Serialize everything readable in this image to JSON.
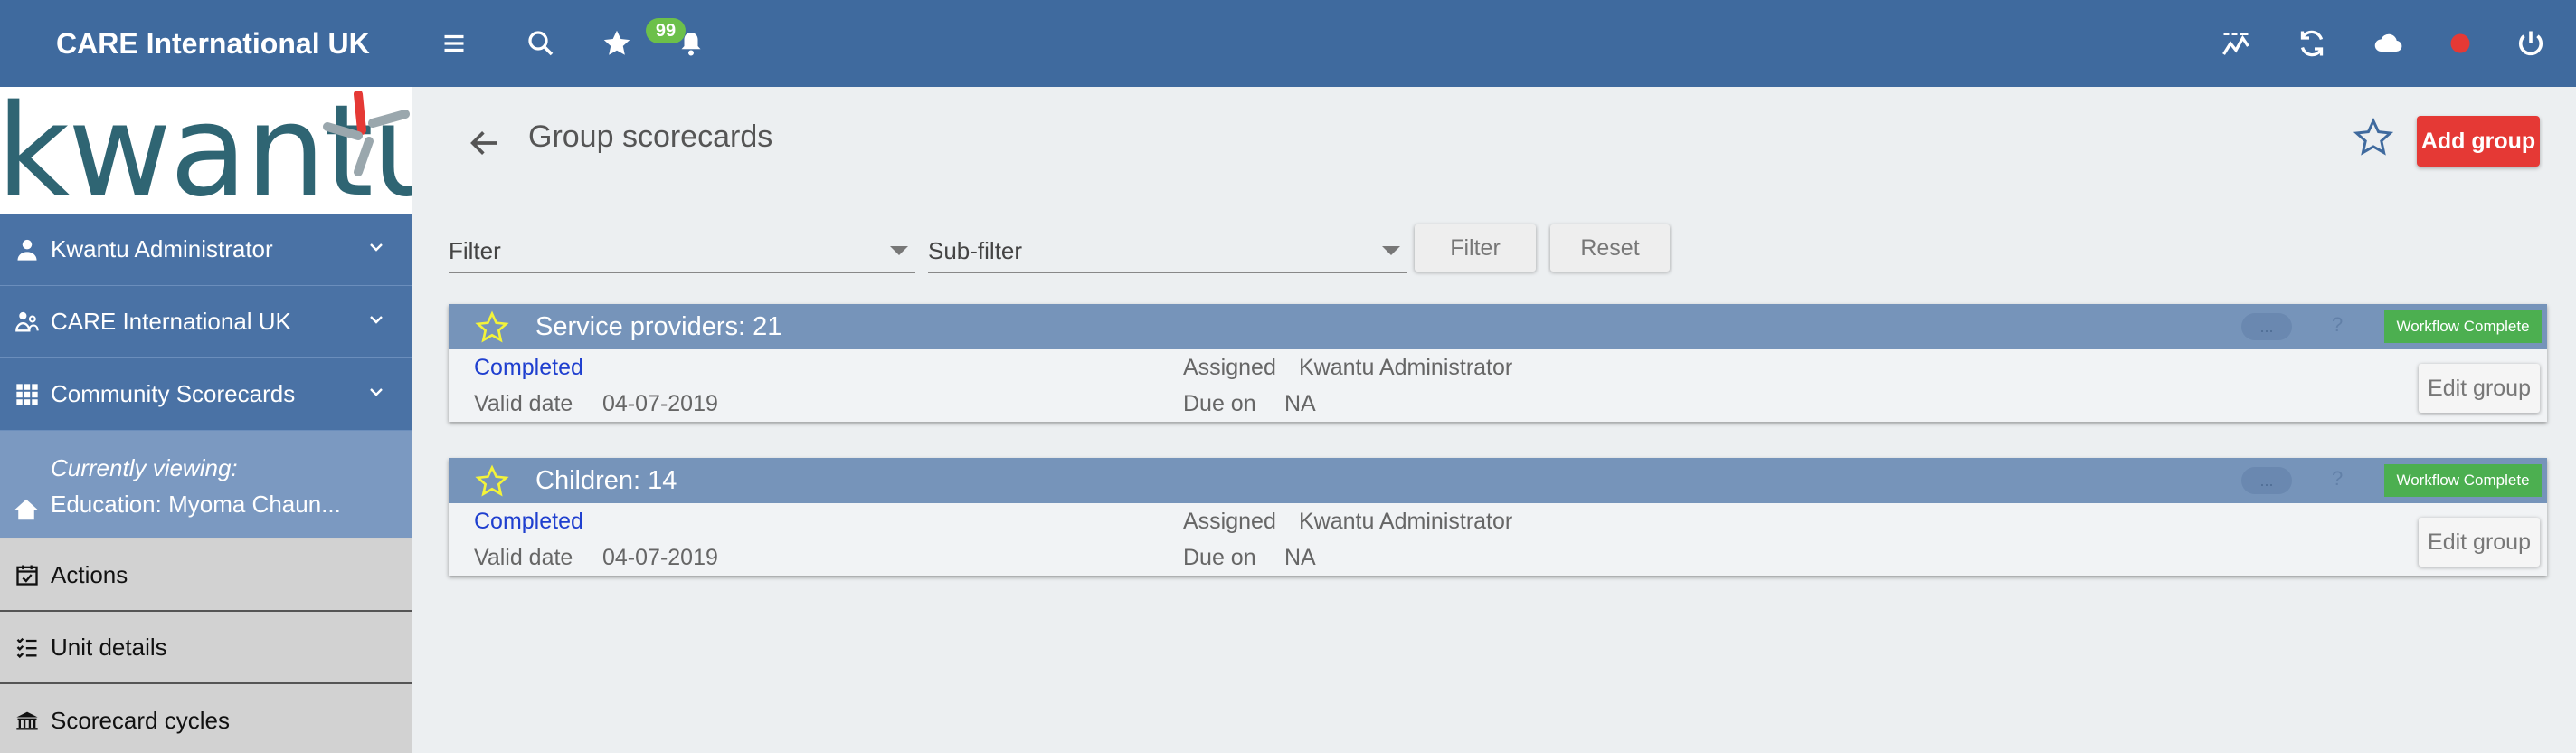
{
  "header": {
    "app_title": "CARE International UK",
    "notification_count": "99",
    "icons": [
      "menu-icon",
      "search-icon",
      "star-icon",
      "bell-icon",
      "analytics-icon",
      "sync-icon",
      "cloud-icon",
      "status-dot-icon",
      "power-icon"
    ]
  },
  "sidebar": {
    "logo_text": "kwantu",
    "items": [
      {
        "label": "Kwantu Administrator",
        "icon": "person-icon"
      },
      {
        "label": "CARE International UK",
        "icon": "organization-icon"
      },
      {
        "label": "Community Scorecards",
        "icon": "grid-icon"
      }
    ],
    "viewing": {
      "caption": "Currently viewing:",
      "name": "Education: Myoma Chaun..."
    },
    "links": [
      {
        "label": "Actions",
        "icon": "calendar-check-icon"
      },
      {
        "label": "Unit details",
        "icon": "checklist-icon"
      },
      {
        "label": "Scorecard cycles",
        "icon": "building-icon"
      }
    ]
  },
  "page": {
    "title": "Group scorecards",
    "add_button": "Add group"
  },
  "filters": {
    "filter_label": "Filter",
    "subfilter_label": "Sub-filter",
    "filter_button": "Filter",
    "reset_button": "Reset"
  },
  "cards": [
    {
      "title": "Service providers: 21",
      "dots": "...",
      "help": "?",
      "badge": "Workflow Complete",
      "status": "Completed",
      "valid_date_label": "Valid date",
      "valid_date": "04-07-2019",
      "assigned_label": "Assigned",
      "assigned": "Kwantu Administrator",
      "due_label": "Due on",
      "due": "NA",
      "edit_button": "Edit group"
    },
    {
      "title": "Children: 14",
      "dots": "...",
      "help": "?",
      "badge": "Workflow Complete",
      "status": "Completed",
      "valid_date_label": "Valid date",
      "valid_date": "04-07-2019",
      "assigned_label": "Assigned",
      "assigned": "Kwantu Administrator",
      "due_label": "Due on",
      "due": "NA",
      "edit_button": "Edit group"
    }
  ],
  "colors": {
    "header": "#3f6a9e",
    "accent_red": "#e53935",
    "badge_green": "#4caf50",
    "status_blue": "#1f3fcf"
  }
}
